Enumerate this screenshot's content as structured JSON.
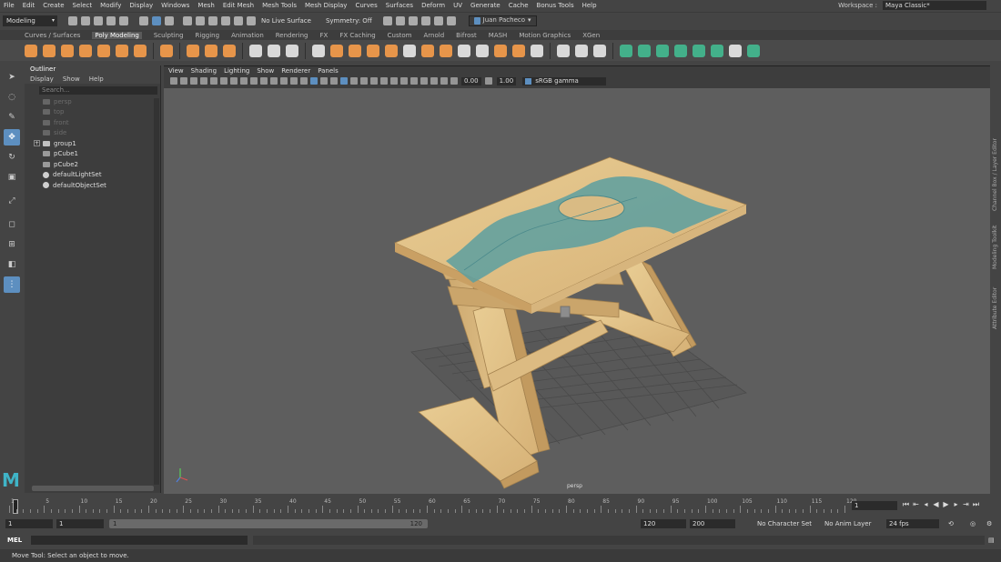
{
  "menubar": {
    "items": [
      "File",
      "Edit",
      "Create",
      "Select",
      "Modify",
      "Display",
      "Windows",
      "Mesh",
      "Edit Mesh",
      "Mesh Tools",
      "Mesh Display",
      "Curves",
      "Surfaces",
      "Deform",
      "UV",
      "Generate",
      "Cache",
      "Bonus Tools",
      "Help"
    ],
    "workspace_label": "Workspace :",
    "workspace_value": "Maya Classic*"
  },
  "statusline": {
    "mode": "Modeling",
    "live_surface": "No Live Surface",
    "symmetry": "Symmetry: Off",
    "user": "Juan Pacheco"
  },
  "shelf_tabs": [
    "Curves / Surfaces",
    "Poly Modeling",
    "Sculpting",
    "Rigging",
    "Animation",
    "Rendering",
    "FX",
    "FX Caching",
    "Custom",
    "Arnold",
    "Bifrost",
    "MASH",
    "Motion Graphics",
    "XGen"
  ],
  "shelf_active": "Poly Modeling",
  "outliner": {
    "title": "Outliner",
    "menu": [
      "Display",
      "Show",
      "Help"
    ],
    "search_placeholder": "Search...",
    "items": [
      {
        "label": "persp",
        "dim": true
      },
      {
        "label": "top",
        "dim": true
      },
      {
        "label": "front",
        "dim": true
      },
      {
        "label": "side",
        "dim": true
      },
      {
        "label": "group1",
        "dim": false
      },
      {
        "label": "pCube1",
        "dim": false
      },
      {
        "label": "pCube2",
        "dim": false
      },
      {
        "label": "defaultLightSet",
        "dim": false
      },
      {
        "label": "defaultObjectSet",
        "dim": false
      }
    ]
  },
  "viewport": {
    "menu": [
      "View",
      "Shading",
      "Lighting",
      "Show",
      "Renderer",
      "Panels"
    ],
    "exposure": "0.00",
    "gamma": "1.00",
    "color_space": "sRGB gamma",
    "camera": "persp"
  },
  "side_tabs": [
    "Channel Box / Layer Editor",
    "Modeling Toolkit",
    "Attribute Editor"
  ],
  "timeline": {
    "ticks": [
      "1",
      "5",
      "10",
      "15",
      "20",
      "25",
      "30",
      "35",
      "40",
      "45",
      "50",
      "55",
      "60",
      "65",
      "70",
      "75",
      "80",
      "85",
      "90",
      "95",
      "100",
      "105",
      "110",
      "115",
      "120"
    ],
    "current_frame": "1"
  },
  "range": {
    "start": "1",
    "playback_start": "1",
    "bar_start": "1",
    "bar_end": "120",
    "playback_end": "120",
    "end": "200",
    "character_set": "No Character Set",
    "anim_layer": "No Anim Layer",
    "fps": "24 fps"
  },
  "cmdline": {
    "label": "MEL"
  },
  "help": {
    "text": "Move Tool: Select an object to move."
  }
}
